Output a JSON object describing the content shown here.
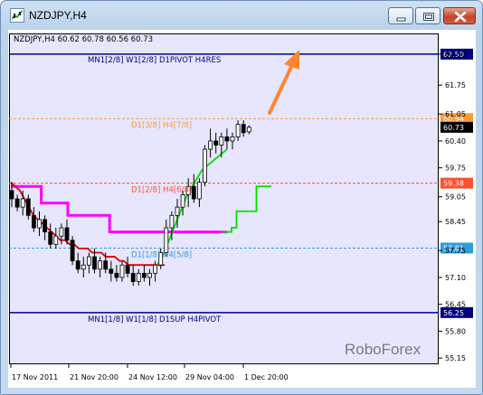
{
  "window": {
    "title": "NZDJPY,H4",
    "buttons": {
      "minimize": "minimize-icon",
      "maximize": "maximize-icon",
      "close": "close-icon"
    }
  },
  "chart": {
    "info_text": "NZDJPY,H4  60.62 60.78 60.56 60.73",
    "watermark": "RoboForex",
    "colors": {
      "background": "#e6e6ff",
      "level_navy": "#000080",
      "level_orange": "#ff9933",
      "level_red": "#ff5030",
      "level_blue": "#2f9ce0",
      "arrow": "#ff8533",
      "magenta": "#ff00ff",
      "red_line": "#e00000",
      "green_line": "#00e000",
      "candles": "#000000"
    }
  },
  "chart_data": {
    "type": "candlestick",
    "ylim": [
      55.0,
      63.0
    ],
    "y_ticks": [
      "62.50",
      "61.75",
      "61.05",
      "60.40",
      "59.75",
      "59.05",
      "58.45",
      "57.75",
      "57.10",
      "56.45",
      "55.80",
      "55.15"
    ],
    "x_ticks": [
      "17 Nov 2011",
      "21 Nov 20:00",
      "24 Nov 12:00",
      "29 Nov 04:00",
      "1 Dec 20:00"
    ],
    "current_price": "60.73",
    "levels": [
      {
        "name": "MN1[2/8] W1[2/8] D1PIVOT H4RES",
        "value": "62.50",
        "style": "solid",
        "color": "#000080"
      },
      {
        "name": "D1[3/8] H4[7/8]",
        "value": "60.94",
        "style": "dashed",
        "color": "#ff9933"
      },
      {
        "name": "D1[2/8] H4[6/8]",
        "value": "59.38",
        "style": "dashed",
        "color": "#ff5030"
      },
      {
        "name": "D1[1/8] H4[5/8]",
        "value": "57.81",
        "style": "dashed",
        "color": "#2f9ce0"
      },
      {
        "name": "MN1[1/8] W1[1/8] D1SUP H4PIVOT",
        "value": "56.25",
        "style": "solid",
        "color": "#000080"
      }
    ],
    "series": [
      {
        "color": "#ff00ff",
        "values": [
          59.3,
          59.3,
          59.3,
          59.3,
          59.3,
          59.3,
          59.3,
          59.3,
          58.9,
          58.9,
          58.9,
          58.9,
          58.9,
          58.9,
          58.9,
          58.6,
          58.6,
          58.6,
          58.6,
          58.6,
          58.6,
          58.6,
          58.6,
          58.6,
          58.6,
          58.6,
          58.2,
          58.2,
          58.2,
          58.2,
          58.2,
          58.2,
          58.2,
          58.2,
          58.2,
          58.2,
          58.2,
          58.2,
          58.2,
          58.2,
          58.2,
          58.2,
          58.2,
          58.2,
          58.2,
          58.2,
          58.2,
          58.2,
          58.2,
          58.2,
          58.2,
          58.2,
          58.2,
          58.2,
          58.2,
          58.2,
          58.2,
          58.2
        ]
      },
      {
        "color": "#e00000",
        "values": [
          59.4,
          59.3,
          59.2,
          59.0,
          58.8,
          58.6,
          58.5,
          58.4,
          58.3,
          58.2,
          58.1,
          58.0,
          58.0,
          57.9,
          57.9,
          57.8,
          57.8,
          57.8,
          57.7,
          57.7,
          57.7,
          57.6,
          57.6,
          57.6,
          57.5,
          57.5,
          57.4,
          57.4,
          57.4,
          57.4,
          57.4,
          57.4,
          57.4,
          57.4,
          57.4
        ]
      },
      {
        "color": "#00e000",
        "values": [
          57.4,
          57.6,
          57.9,
          58.2,
          58.5,
          58.8,
          59.1,
          59.3,
          59.5,
          59.7,
          59.8,
          59.9,
          60.0,
          60.1,
          60.2
        ]
      },
      {
        "color": "#00e000",
        "values": [
          58.2,
          58.2,
          58.3,
          58.7,
          58.7,
          58.7,
          58.7,
          59.3,
          59.3,
          59.3,
          59.3
        ]
      }
    ],
    "candles": [
      [
        59.2,
        59.4,
        58.8,
        59.0
      ],
      [
        59.0,
        59.1,
        58.7,
        58.8
      ],
      [
        58.8,
        59.2,
        58.6,
        59.0
      ],
      [
        59.0,
        59.1,
        58.5,
        58.6
      ],
      [
        58.6,
        58.8,
        58.2,
        58.3
      ],
      [
        58.3,
        58.7,
        58.1,
        58.5
      ],
      [
        58.5,
        58.6,
        58.0,
        58.2
      ],
      [
        58.2,
        58.4,
        57.8,
        57.9
      ],
      [
        57.9,
        58.3,
        57.8,
        58.1
      ],
      [
        58.1,
        58.4,
        57.9,
        58.3
      ],
      [
        58.3,
        58.5,
        57.9,
        58.0
      ],
      [
        58.0,
        58.1,
        57.4,
        57.5
      ],
      [
        57.5,
        57.7,
        57.2,
        57.3
      ],
      [
        57.3,
        57.6,
        57.1,
        57.4
      ],
      [
        57.4,
        57.7,
        57.2,
        57.6
      ],
      [
        57.6,
        57.8,
        57.2,
        57.3
      ],
      [
        57.3,
        57.6,
        57.1,
        57.5
      ],
      [
        57.5,
        57.7,
        57.2,
        57.3
      ],
      [
        57.3,
        57.5,
        57.0,
        57.2
      ],
      [
        57.2,
        57.4,
        57.0,
        57.1
      ],
      [
        57.1,
        57.5,
        57.0,
        57.4
      ],
      [
        57.4,
        57.6,
        57.1,
        57.2
      ],
      [
        57.2,
        57.4,
        56.9,
        57.0
      ],
      [
        57.0,
        57.3,
        56.9,
        57.2
      ],
      [
        57.2,
        57.4,
        57.0,
        57.1
      ],
      [
        57.1,
        57.3,
        56.9,
        57.2
      ],
      [
        57.2,
        57.5,
        57.0,
        57.4
      ],
      [
        57.4,
        57.8,
        57.3,
        57.7
      ],
      [
        57.7,
        58.5,
        57.6,
        58.3
      ],
      [
        58.3,
        58.7,
        58.0,
        58.6
      ],
      [
        58.6,
        59.0,
        58.3,
        58.8
      ],
      [
        58.8,
        59.2,
        58.6,
        59.1
      ],
      [
        59.1,
        59.5,
        58.8,
        59.3
      ],
      [
        59.3,
        59.6,
        58.9,
        59.0
      ],
      [
        59.0,
        59.5,
        58.8,
        59.4
      ],
      [
        59.4,
        60.3,
        59.3,
        60.2
      ],
      [
        60.2,
        60.7,
        60.0,
        60.4
      ],
      [
        60.4,
        60.6,
        60.1,
        60.3
      ],
      [
        60.3,
        60.6,
        60.0,
        60.5
      ],
      [
        60.5,
        60.7,
        60.2,
        60.4
      ],
      [
        60.4,
        60.6,
        60.2,
        60.5
      ],
      [
        60.5,
        60.9,
        60.4,
        60.8
      ],
      [
        60.8,
        60.9,
        60.5,
        60.6
      ],
      [
        60.62,
        60.78,
        60.56,
        60.73
      ]
    ]
  }
}
